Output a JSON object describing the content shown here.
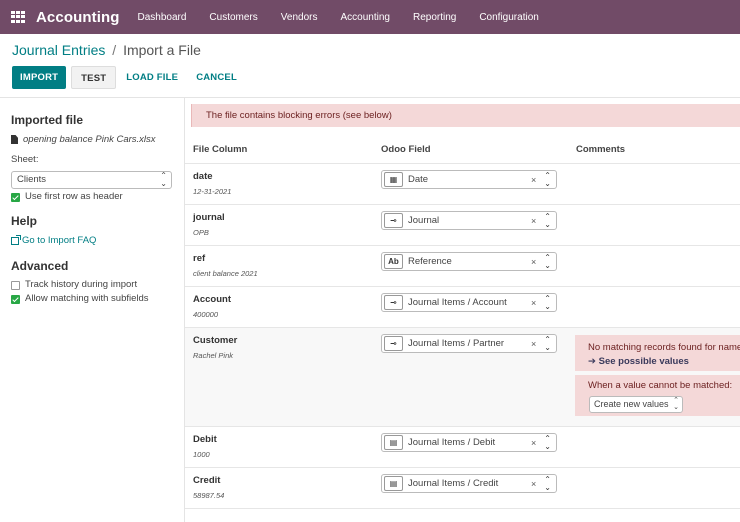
{
  "app": {
    "title": "Accounting"
  },
  "nav": {
    "items": [
      "Dashboard",
      "Customers",
      "Vendors",
      "Accounting",
      "Reporting",
      "Configuration"
    ]
  },
  "breadcrumb": {
    "parent": "Journal Entries",
    "separator": "/",
    "current": "Import a File"
  },
  "toolbar": {
    "import_label": "IMPORT",
    "test_label": "TEST",
    "load_label": "LOAD FILE",
    "cancel_label": "CANCEL"
  },
  "sidebar": {
    "imported_file_heading": "Imported file",
    "file_name": "opening balance Pink Cars.xlsx",
    "sheet_label": "Sheet:",
    "sheet_value": "Clients",
    "first_row_header_label": "Use first row as header",
    "first_row_header_checked": true,
    "help_heading": "Help",
    "faq_link": "Go to Import FAQ",
    "advanced_heading": "Advanced",
    "track_history_label": "Track history during import",
    "track_history_checked": false,
    "allow_matching_label": "Allow matching with subfields",
    "allow_matching_checked": true
  },
  "alert": {
    "text": "The file contains blocking errors (see below)"
  },
  "table": {
    "headers": {
      "file_column": "File Column",
      "odoo_field": "Odoo Field",
      "comments": "Comments"
    },
    "rows": [
      {
        "name": "date",
        "sample": "12-31-2021",
        "field_icon": "calendar-icon",
        "field": "Date"
      },
      {
        "name": "journal",
        "sample": "OPB",
        "field_icon": "relation-icon",
        "field": "Journal"
      },
      {
        "name": "ref",
        "sample": "client balance 2021",
        "field_icon": "text-icon",
        "field": "Reference"
      },
      {
        "name": "Account",
        "sample": "400000",
        "field_icon": "relation-icon",
        "field": "Journal Items / Account"
      },
      {
        "name": "Customer",
        "sample": "Rachel Pink",
        "field_icon": "relation-icon",
        "field": "Journal Items / Partner"
      },
      {
        "name": "Debit",
        "sample": "1000",
        "field_icon": "document-icon",
        "field": "Journal Items / Debit"
      },
      {
        "name": "Credit",
        "sample": "58987.54",
        "field_icon": "document-icon",
        "field": "Journal Items / Credit"
      }
    ]
  },
  "customer_comment": {
    "error_text": "No matching records found for name",
    "see_values_link": "See possible values",
    "unmatched_label": "When a value cannot be matched:",
    "unmatched_option": "Create new values"
  },
  "icons": {
    "text_badge": "Ab",
    "clear": "×",
    "arrows": "⌃⌄"
  },
  "colors": {
    "navbar": "#714b67",
    "accent": "#017e84",
    "error_bg": "#f4d8d8"
  }
}
